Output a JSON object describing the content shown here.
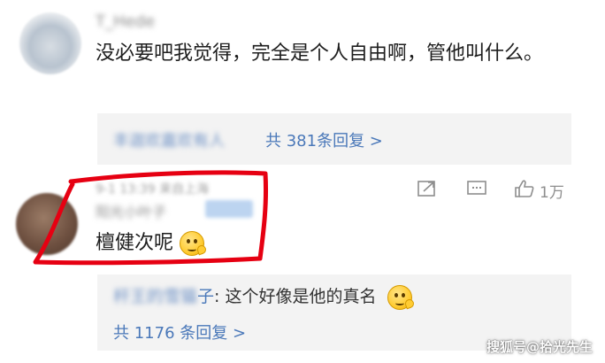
{
  "comment1": {
    "username": "T_Hede",
    "text": "没必要吧我觉得，完全是个人自由啊，管他叫什么。",
    "replies": {
      "preview_blurred": "丰迦欢嘉欢有人",
      "count_label": "共 381条回复 >"
    }
  },
  "comment2": {
    "meta_blurred": "9-1 13:39 来自上海",
    "username_blurred": "阳光小叶子",
    "text": "檀健次呢",
    "emoji": "thinking-face-icon",
    "actions": {
      "share_icon": "share-icon",
      "comment_icon": "comment-icon",
      "like_icon": "thumbs-up-icon",
      "like_count": "1万"
    },
    "replies": {
      "preview_user_blurred": "杆王的雪猫",
      "preview_user_visible": "子",
      "preview_text": ": 这个好像是他的真名",
      "count_label": "共 1176 条回复 >"
    }
  },
  "annotation": {
    "color": "#e60012"
  },
  "watermark": "搜狐号@拾光先生"
}
